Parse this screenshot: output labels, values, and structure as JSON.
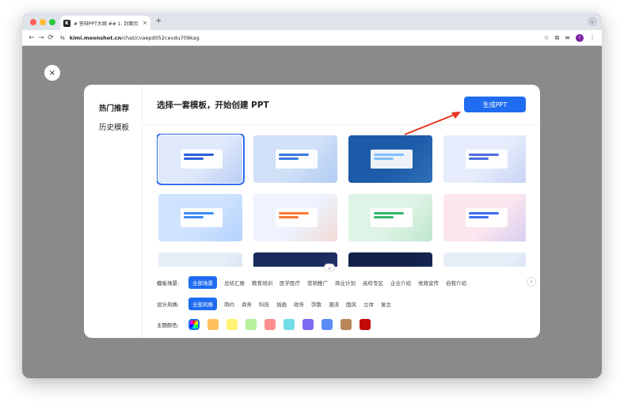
{
  "browser": {
    "tab": {
      "favicon": "K",
      "title": "# 答辩PPT大纲 ## 1. 封面页 ·",
      "close": "×"
    },
    "new_tab": "+",
    "menu_icon": "⌄",
    "url_domain": "kimi.moonshot.cn",
    "url_path": "/chat/cvaepd052cevdu709kag",
    "icons": {
      "back": "←",
      "forward": "→",
      "reload": "⟳",
      "site": "⇆",
      "bookmark": "☆",
      "extension": "⧉",
      "media": "≡",
      "more": "⋮"
    },
    "profile_initial": "I"
  },
  "dialog": {
    "close_icon": "×",
    "sidebar": [
      {
        "label": "热门推荐",
        "active": true
      },
      {
        "label": "历史模板",
        "active": false
      }
    ],
    "title": "选择一套模板，开始创建 PPT",
    "generate_button": "生成PPT",
    "scroll_icon": "⌄",
    "filters": {
      "scene_label": "模板场景:",
      "scene_options": [
        "全部场景",
        "总结汇报",
        "教育培训",
        "医学医疗",
        "营销推广",
        "商业计划",
        "高校专区",
        "企业介绍",
        "党政宣传",
        "自我介绍"
      ],
      "scene_selected": "全部场景",
      "next_icon": "›",
      "style_label": "设计风格:",
      "style_options": [
        "全部风格",
        "简约",
        "商务",
        "科技",
        "插画",
        "政务",
        "弥散",
        "潮流",
        "国风",
        "立体",
        "复古"
      ],
      "style_selected": "全部风格",
      "color_label": "主题颜色:",
      "colors": [
        "#ffbf5e",
        "#fff275",
        "#b5f09a",
        "#ff8f8f",
        "#6fdce6",
        "#7a6bf0",
        "#5b8cf5",
        "#b8865a",
        "#c40a0a"
      ]
    },
    "templates": [
      {
        "bg": "#dfe9fb",
        "accent": "#2a5fd6",
        "selected": true
      },
      {
        "bg": "#cfe0f7",
        "accent": "#3a78e0",
        "selected": false
      },
      {
        "bg": "#1d5ba8",
        "accent": "#7fc0ff",
        "selected": false
      },
      {
        "bg": "#e6ecfb",
        "accent": "#4d6fe0",
        "selected": false
      },
      {
        "bg": "#cfe3ff",
        "accent": "#3d8cf5",
        "selected": false
      },
      {
        "bg": "#eef3ff",
        "accent": "#ff7a2e",
        "selected": false
      },
      {
        "bg": "#dff3e6",
        "accent": "#33b86a",
        "selected": false
      },
      {
        "bg": "#fde6ef",
        "accent": "#3a6df0",
        "selected": false
      },
      {
        "bg": "#e8eef8",
        "accent": "#5a7bd6",
        "selected": false
      },
      {
        "bg": "#1a2a5c",
        "accent": "#5b8cf5",
        "selected": false
      },
      {
        "bg": "#13204a",
        "accent": "#4a7bf0",
        "selected": false
      },
      {
        "bg": "#e8eef8",
        "accent": "#4d6fe0",
        "selected": false
      }
    ]
  }
}
